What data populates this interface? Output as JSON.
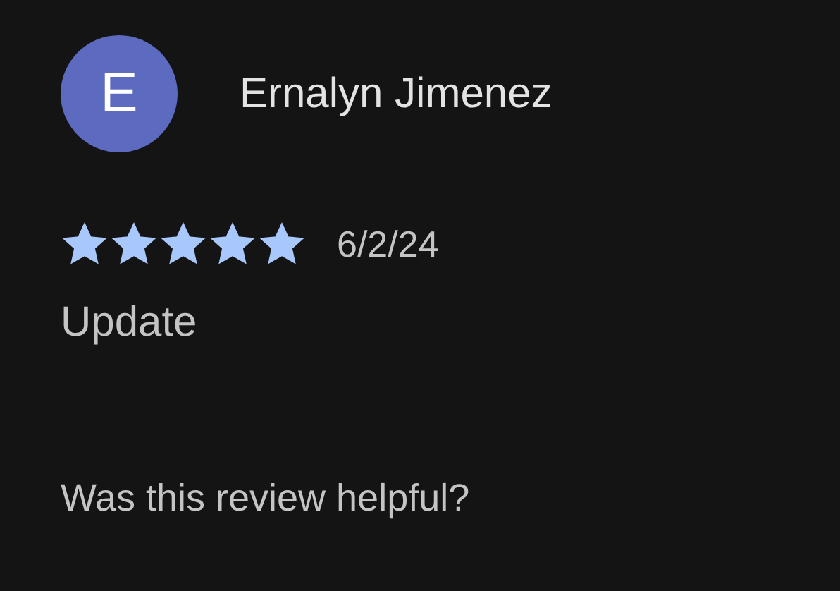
{
  "review": {
    "avatar_letter": "E",
    "author": "Ernalyn Jimenez",
    "stars": 5,
    "date": "6/2/24",
    "text": "Update"
  },
  "helpful_prompt": "Was this review helpful?"
}
